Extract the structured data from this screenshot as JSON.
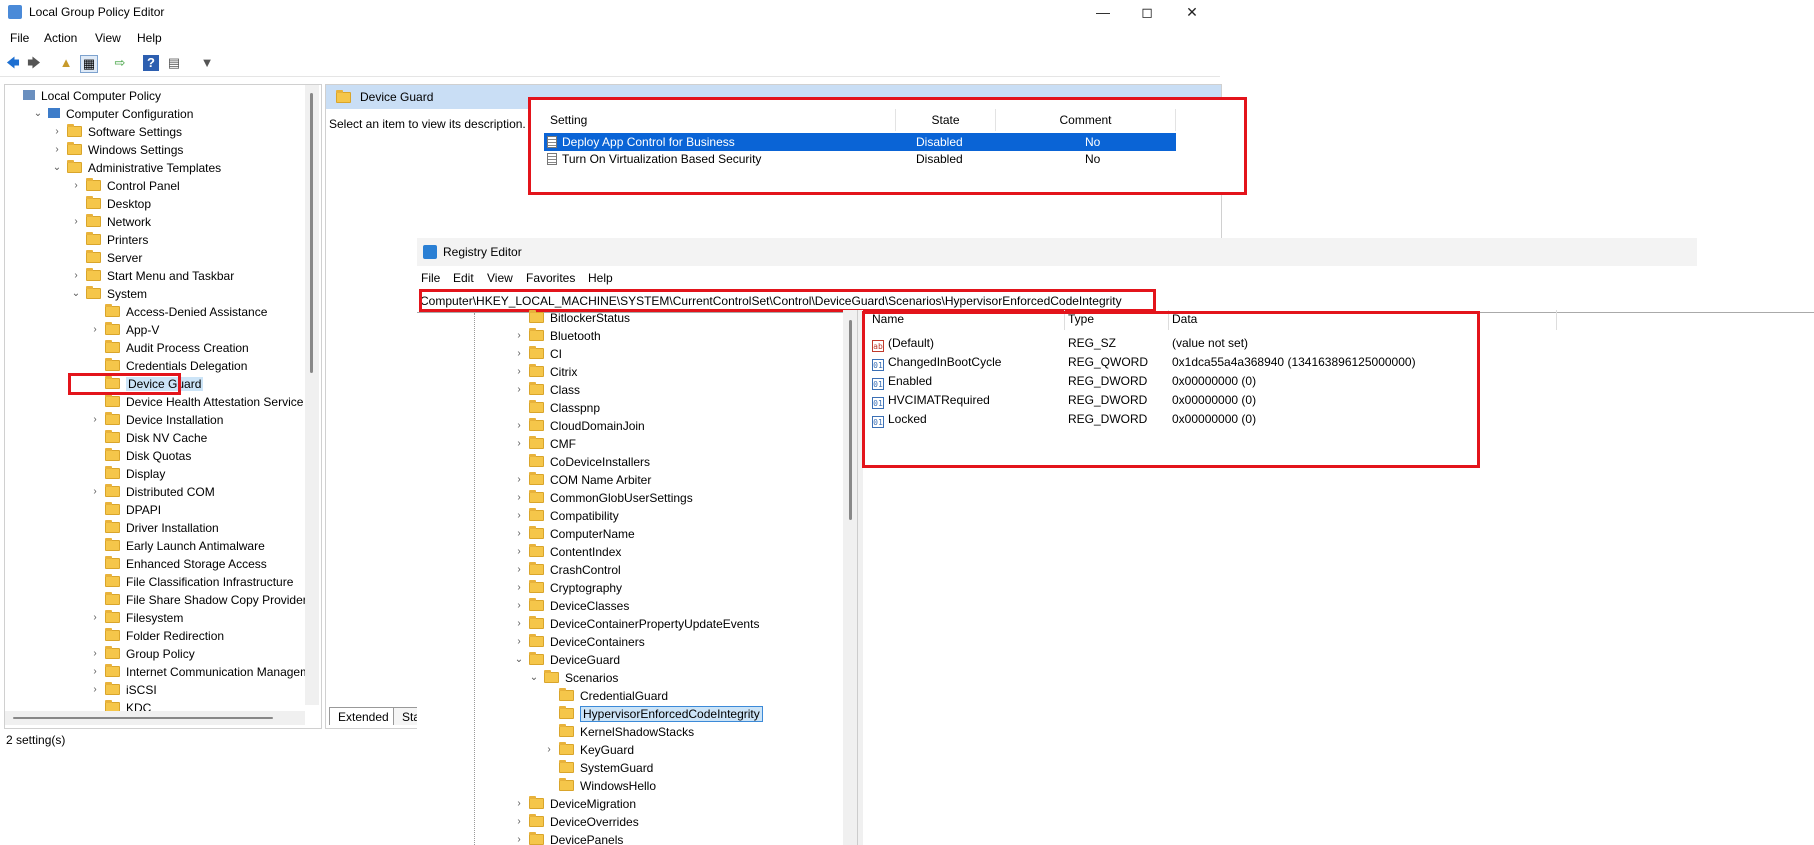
{
  "gpe": {
    "title": "Local Group Policy Editor",
    "menu": [
      "File",
      "Action",
      "View",
      "Help"
    ],
    "tree": [
      {
        "label": "Local Computer Policy",
        "indent": 0,
        "exp": ""
      },
      {
        "label": "Computer Configuration",
        "indent": 1,
        "exp": "v"
      },
      {
        "label": "Software Settings",
        "indent": 2,
        "exp": ">"
      },
      {
        "label": "Windows Settings",
        "indent": 2,
        "exp": ">"
      },
      {
        "label": "Administrative Templates",
        "indent": 2,
        "exp": "v"
      },
      {
        "label": "Control Panel",
        "indent": 3,
        "exp": ">"
      },
      {
        "label": "Desktop",
        "indent": 3,
        "exp": ""
      },
      {
        "label": "Network",
        "indent": 3,
        "exp": ">"
      },
      {
        "label": "Printers",
        "indent": 3,
        "exp": ""
      },
      {
        "label": "Server",
        "indent": 3,
        "exp": ""
      },
      {
        "label": "Start Menu and Taskbar",
        "indent": 3,
        "exp": ">"
      },
      {
        "label": "System",
        "indent": 3,
        "exp": "v"
      },
      {
        "label": "Access-Denied Assistance",
        "indent": 4,
        "exp": ""
      },
      {
        "label": "App-V",
        "indent": 4,
        "exp": ">"
      },
      {
        "label": "Audit Process Creation",
        "indent": 4,
        "exp": ""
      },
      {
        "label": "Credentials Delegation",
        "indent": 4,
        "exp": ""
      },
      {
        "label": "Device Guard",
        "indent": 4,
        "exp": "",
        "selected": true
      },
      {
        "label": "Device Health Attestation Service",
        "indent": 4,
        "exp": ""
      },
      {
        "label": "Device Installation",
        "indent": 4,
        "exp": ">"
      },
      {
        "label": "Disk NV Cache",
        "indent": 4,
        "exp": ""
      },
      {
        "label": "Disk Quotas",
        "indent": 4,
        "exp": ""
      },
      {
        "label": "Display",
        "indent": 4,
        "exp": ""
      },
      {
        "label": "Distributed COM",
        "indent": 4,
        "exp": ">"
      },
      {
        "label": "DPAPI",
        "indent": 4,
        "exp": ""
      },
      {
        "label": "Driver Installation",
        "indent": 4,
        "exp": ""
      },
      {
        "label": "Early Launch Antimalware",
        "indent": 4,
        "exp": ""
      },
      {
        "label": "Enhanced Storage Access",
        "indent": 4,
        "exp": ""
      },
      {
        "label": "File Classification Infrastructure",
        "indent": 4,
        "exp": ""
      },
      {
        "label": "File Share Shadow Copy Provider",
        "indent": 4,
        "exp": ""
      },
      {
        "label": "Filesystem",
        "indent": 4,
        "exp": ">"
      },
      {
        "label": "Folder Redirection",
        "indent": 4,
        "exp": ""
      },
      {
        "label": "Group Policy",
        "indent": 4,
        "exp": ">"
      },
      {
        "label": "Internet Communication Manageme",
        "indent": 4,
        "exp": ">"
      },
      {
        "label": "iSCSI",
        "indent": 4,
        "exp": ">"
      },
      {
        "label": "KDC",
        "indent": 4,
        "exp": ""
      }
    ],
    "panel_title": "Device Guard",
    "description": "Select an item to view its description.",
    "columns": [
      "Setting",
      "State",
      "Comment"
    ],
    "settings": [
      {
        "name": "Deploy App Control for Business",
        "state": "Disabled",
        "comment": "No",
        "selected": true
      },
      {
        "name": "Turn On Virtualization Based Security",
        "state": "Disabled",
        "comment": "No"
      }
    ],
    "tabs": [
      "Extended",
      "Star"
    ],
    "status": "2 setting(s)"
  },
  "reg": {
    "title": "Registry Editor",
    "menu": [
      "File",
      "Edit",
      "View",
      "Favorites",
      "Help"
    ],
    "address": "Computer\\HKEY_LOCAL_MACHINE\\SYSTEM\\CurrentControlSet\\Control\\DeviceGuard\\Scenarios\\HypervisorEnforcedCodeIntegrity",
    "tree": [
      {
        "label": "BitlockerStatus",
        "indent": 0,
        "exp": ""
      },
      {
        "label": "Bluetooth",
        "indent": 0,
        "exp": ">"
      },
      {
        "label": "CI",
        "indent": 0,
        "exp": ">"
      },
      {
        "label": "Citrix",
        "indent": 0,
        "exp": ">"
      },
      {
        "label": "Class",
        "indent": 0,
        "exp": ">"
      },
      {
        "label": "Classpnp",
        "indent": 0,
        "exp": ""
      },
      {
        "label": "CloudDomainJoin",
        "indent": 0,
        "exp": ">"
      },
      {
        "label": "CMF",
        "indent": 0,
        "exp": ">"
      },
      {
        "label": "CoDeviceInstallers",
        "indent": 0,
        "exp": ""
      },
      {
        "label": "COM Name Arbiter",
        "indent": 0,
        "exp": ">"
      },
      {
        "label": "CommonGlobUserSettings",
        "indent": 0,
        "exp": ">"
      },
      {
        "label": "Compatibility",
        "indent": 0,
        "exp": ">"
      },
      {
        "label": "ComputerName",
        "indent": 0,
        "exp": ">"
      },
      {
        "label": "ContentIndex",
        "indent": 0,
        "exp": ">"
      },
      {
        "label": "CrashControl",
        "indent": 0,
        "exp": ">"
      },
      {
        "label": "Cryptography",
        "indent": 0,
        "exp": ">"
      },
      {
        "label": "DeviceClasses",
        "indent": 0,
        "exp": ">"
      },
      {
        "label": "DeviceContainerPropertyUpdateEvents",
        "indent": 0,
        "exp": ">"
      },
      {
        "label": "DeviceContainers",
        "indent": 0,
        "exp": ">"
      },
      {
        "label": "DeviceGuard",
        "indent": 0,
        "exp": "v"
      },
      {
        "label": "Scenarios",
        "indent": 1,
        "exp": "v"
      },
      {
        "label": "CredentialGuard",
        "indent": 2,
        "exp": ""
      },
      {
        "label": "HypervisorEnforcedCodeIntegrity",
        "indent": 2,
        "exp": "",
        "selected": true
      },
      {
        "label": "KernelShadowStacks",
        "indent": 2,
        "exp": ""
      },
      {
        "label": "KeyGuard",
        "indent": 2,
        "exp": ">"
      },
      {
        "label": "SystemGuard",
        "indent": 2,
        "exp": ""
      },
      {
        "label": "WindowsHello",
        "indent": 2,
        "exp": ""
      },
      {
        "label": "DeviceMigration",
        "indent": 0,
        "exp": ">"
      },
      {
        "label": "DeviceOverrides",
        "indent": 0,
        "exp": ">"
      },
      {
        "label": "DevicePanels",
        "indent": 0,
        "exp": ">"
      }
    ],
    "columns": [
      "Name",
      "Type",
      "Data"
    ],
    "values": [
      {
        "name": "(Default)",
        "type": "REG_SZ",
        "data": "(value not set)",
        "icon": "ab"
      },
      {
        "name": "ChangedInBootCycle",
        "type": "REG_QWORD",
        "data": "0x1dca55a4a368940 (134163896125000000)",
        "icon": "01"
      },
      {
        "name": "Enabled",
        "type": "REG_DWORD",
        "data": "0x00000000 (0)",
        "icon": "01"
      },
      {
        "name": "HVCIMATRequired",
        "type": "REG_DWORD",
        "data": "0x00000000 (0)",
        "icon": "01"
      },
      {
        "name": "Locked",
        "type": "REG_DWORD",
        "data": "0x00000000 (0)",
        "icon": "01"
      }
    ]
  },
  "colors": {
    "accent": "#0a64d6",
    "highlight_red": "#e3141b",
    "folder": "#f5c64a",
    "selection": "#cce4f7"
  }
}
